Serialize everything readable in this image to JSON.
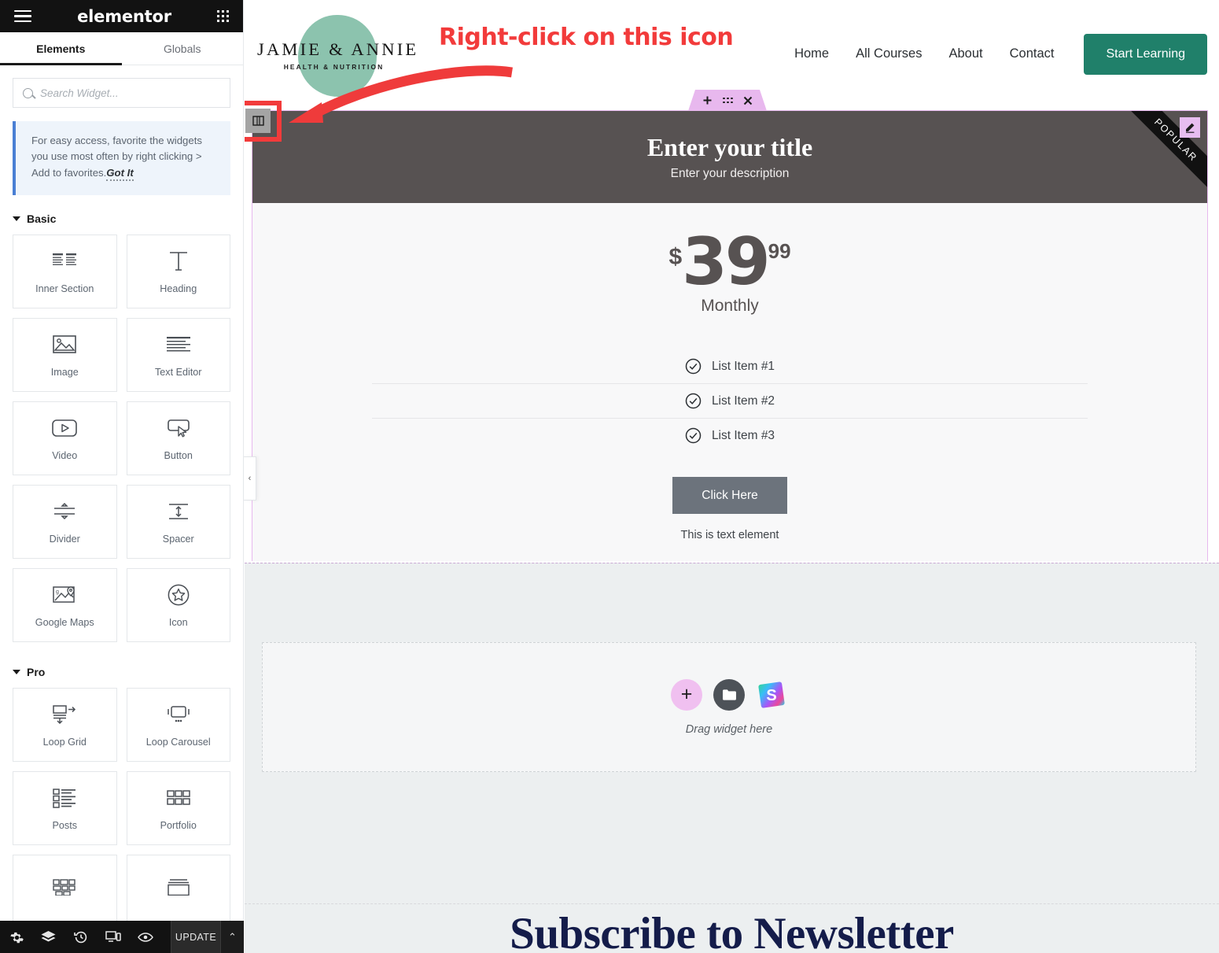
{
  "panel": {
    "brand": "elementor",
    "menu_icon": "hamburger-icon",
    "apps_icon": "apps-grid-icon",
    "tabs": [
      {
        "label": "Elements",
        "active": true
      },
      {
        "label": "Globals",
        "active": false
      }
    ],
    "search": {
      "placeholder": "Search Widget...",
      "value": ""
    },
    "notice": {
      "text": "For easy access, favorite the widgets you use most often by right clicking > Add to favorites.",
      "action": "Got It"
    },
    "categories": [
      {
        "name": "Basic",
        "widgets": [
          {
            "label": "Inner Section",
            "icon": "inner-section-icon"
          },
          {
            "label": "Heading",
            "icon": "heading-icon"
          },
          {
            "label": "Image",
            "icon": "image-icon"
          },
          {
            "label": "Text Editor",
            "icon": "text-editor-icon"
          },
          {
            "label": "Video",
            "icon": "video-icon"
          },
          {
            "label": "Button",
            "icon": "button-icon"
          },
          {
            "label": "Divider",
            "icon": "divider-icon"
          },
          {
            "label": "Spacer",
            "icon": "spacer-icon"
          },
          {
            "label": "Google Maps",
            "icon": "google-maps-icon"
          },
          {
            "label": "Icon",
            "icon": "star-icon"
          }
        ]
      },
      {
        "name": "Pro",
        "widgets": [
          {
            "label": "Loop Grid",
            "icon": "loop-grid-icon"
          },
          {
            "label": "Loop Carousel",
            "icon": "loop-carousel-icon"
          },
          {
            "label": "Posts",
            "icon": "posts-icon"
          },
          {
            "label": "Portfolio",
            "icon": "portfolio-icon"
          }
        ]
      }
    ],
    "footer": {
      "buttons": [
        {
          "name": "settings",
          "icon": "gear-icon"
        },
        {
          "name": "navigator",
          "icon": "layers-icon"
        },
        {
          "name": "history",
          "icon": "history-icon"
        },
        {
          "name": "responsive",
          "icon": "responsive-mode-icon"
        },
        {
          "name": "preview",
          "icon": "eye-icon"
        }
      ],
      "update_label": "UPDATE",
      "caret": "⌃"
    },
    "collapse_chevron": "‹"
  },
  "annotation": {
    "text": "Right-click on this icon",
    "color": "#f23b3b"
  },
  "site": {
    "logo": {
      "main": "JAMIE & ANNIE",
      "sub": "HEALTH & NUTRITION",
      "blob_color": "#8cc3ae"
    },
    "nav": [
      {
        "label": "Home"
      },
      {
        "label": "All Courses"
      },
      {
        "label": "About"
      },
      {
        "label": "Contact"
      }
    ],
    "cta": {
      "label": "Start Learning",
      "color": "#20806a"
    }
  },
  "editor": {
    "column_handle_icon": "column-layout-icon",
    "section_toolbar": {
      "add_icon": "plus-icon",
      "drag_icon": "drag-handle-icon",
      "close_icon": "close-icon",
      "color": "#e8b8ee"
    },
    "edit_badge_icon": "pencil-icon"
  },
  "pricing": {
    "title": "Enter your title",
    "description": "Enter your description",
    "ribbon": "POPULAR",
    "currency": "$",
    "integer": "39",
    "fraction": "99",
    "period": "Monthly",
    "features": [
      {
        "label": "List Item #1",
        "icon": "check-circle-icon"
      },
      {
        "label": "List Item #2",
        "icon": "check-circle-icon"
      },
      {
        "label": "List Item #3",
        "icon": "check-circle-icon"
      }
    ],
    "button": "Click Here",
    "footer_note": "This is text element",
    "header_bg": "#575252"
  },
  "dropzone": {
    "label": "Drag widget here",
    "icons": [
      {
        "name": "add-widget-icon",
        "symbol": "+"
      },
      {
        "name": "folder-icon",
        "symbol": "folder"
      },
      {
        "name": "shutterstock-icon",
        "symbol": "S"
      }
    ]
  },
  "newsletter": {
    "heading": "Subscribe to Newsletter",
    "color": "#141c4a"
  }
}
